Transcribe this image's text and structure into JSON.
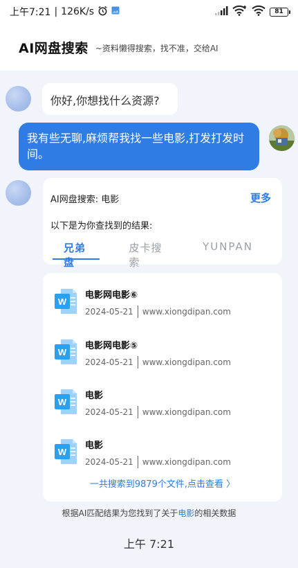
{
  "status_bar": {
    "time": "上午7:21",
    "speed": "126K/s",
    "battery": "81"
  },
  "header": {
    "title": "AI网盘搜索",
    "subtitle": "~资料懒得搜索，找不准，交给AI"
  },
  "messages": {
    "greeting": "你好,你想找什么资源?",
    "user_request": "我有些无聊,麻烦帮我找一些电影,打发打发时间。"
  },
  "result_card": {
    "title": "AI网盘搜索: 电影",
    "more_label": "更多",
    "subtitle": "以下是为你查找到的结果:",
    "tabs": [
      "兄弟盘",
      "皮卡搜索",
      "YUNPAN"
    ],
    "active_tab": 0
  },
  "results": [
    {
      "name": "电影网电影⑥",
      "date": "2024-05-21",
      "source": "www.xiongdipan.com",
      "icon": "word-doc-icon"
    },
    {
      "name": "电影网电影⑤",
      "date": "2024-05-21",
      "source": "www.xiongdipan.com",
      "icon": "word-doc-icon"
    },
    {
      "name": "电影",
      "date": "2024-05-21",
      "source": "www.xiongdipan.com",
      "icon": "word-doc-icon"
    },
    {
      "name": "电影",
      "date": "2024-05-21",
      "source": "www.xiongdipan.com",
      "icon": "word-doc-icon"
    }
  ],
  "total_link": "一共搜索到9879个文件,点击查看 〉",
  "footnote": {
    "prefix": "根据AI匹配结果为您找到了关于",
    "keyword": "电影",
    "suffix": "的相关数据"
  },
  "timestamp": "上午 7:21",
  "colors": {
    "accent": "#2f7ce5",
    "background": "#f1f4fa",
    "card": "#ffffff"
  }
}
